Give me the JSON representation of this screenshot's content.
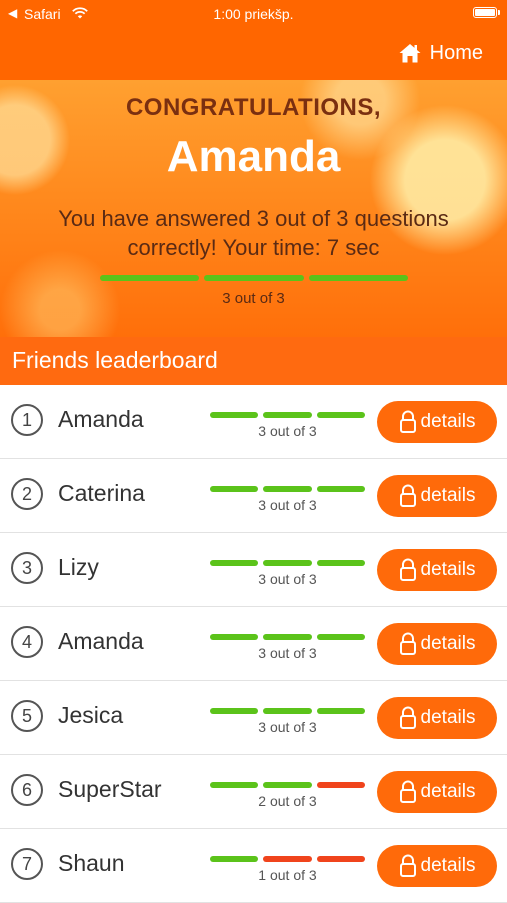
{
  "status_bar": {
    "back_glyph": "◀",
    "carrier": "Safari",
    "time": "1:00 priekšp."
  },
  "nav": {
    "home_label": "Home",
    "home_icon": "house-icon"
  },
  "result": {
    "headline": "CONGRATULATIONS,",
    "name": "Amanda",
    "message": "You have answered 3 out of 3 questions correctly! Your time: 7 sec",
    "progress": [
      "correct",
      "correct",
      "correct"
    ],
    "score_text": "3 out of 3"
  },
  "leaderboard": {
    "title": "Friends leaderboard",
    "details_label": "details",
    "details_icon": "lock-icon",
    "rows": [
      {
        "rank": "1",
        "name": "Amanda",
        "results": [
          "correct",
          "correct",
          "correct"
        ],
        "score_text": "3 out of 3"
      },
      {
        "rank": "2",
        "name": "Caterina",
        "results": [
          "correct",
          "correct",
          "correct"
        ],
        "score_text": "3 out of 3"
      },
      {
        "rank": "3",
        "name": "Lizy",
        "results": [
          "correct",
          "correct",
          "correct"
        ],
        "score_text": "3 out of 3"
      },
      {
        "rank": "4",
        "name": "Amanda",
        "results": [
          "correct",
          "correct",
          "correct"
        ],
        "score_text": "3 out of 3"
      },
      {
        "rank": "5",
        "name": "Jesica",
        "results": [
          "correct",
          "correct",
          "correct"
        ],
        "score_text": "3 out of 3"
      },
      {
        "rank": "6",
        "name": "SuperStar",
        "results": [
          "correct",
          "correct",
          "wrong"
        ],
        "score_text": "2 out of 3"
      },
      {
        "rank": "7",
        "name": "Shaun",
        "results": [
          "correct",
          "wrong",
          "wrong"
        ],
        "score_text": "1 out of 3"
      }
    ]
  },
  "colors": {
    "brand": "#ff6600",
    "correct": "#5bc31a",
    "wrong": "#f0441c"
  }
}
